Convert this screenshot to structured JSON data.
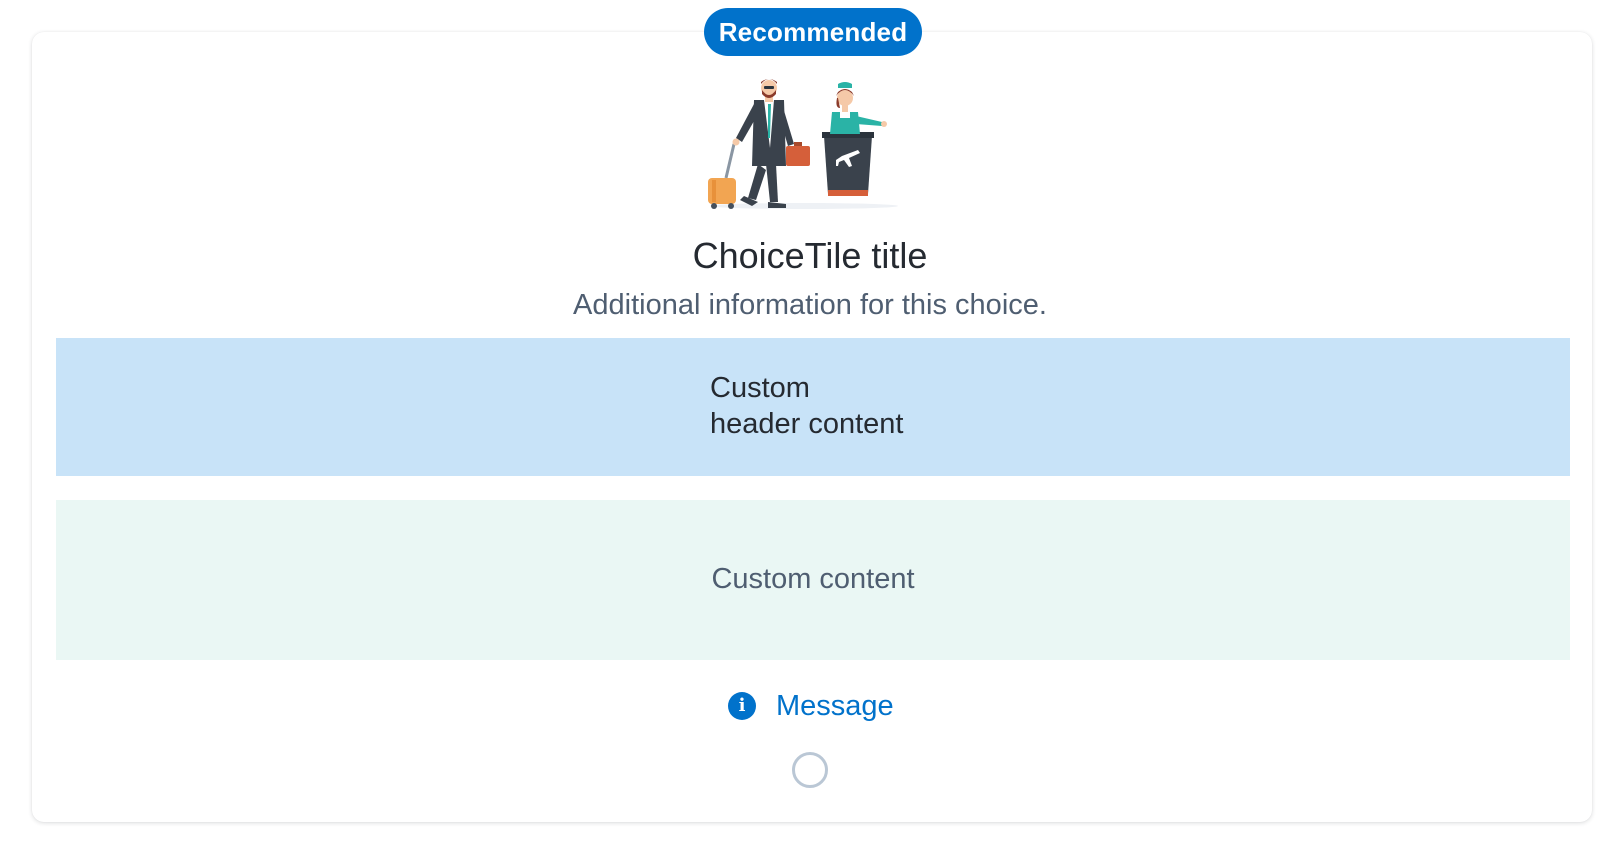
{
  "choice_tile": {
    "badge": "Recommended",
    "title": "ChoiceTile title",
    "description": "Additional information for this choice.",
    "custom_header": {
      "line1": "Custom",
      "line2": "header content"
    },
    "custom_content": "Custom content",
    "message": "Message",
    "message_icon": "info-icon",
    "illustration": "airport-check-in-illustration",
    "selected": false
  },
  "colors": {
    "badge_bg": "#0172cb",
    "header_bg": "#c8e3f8",
    "content_bg": "#eaf7f4",
    "message": "#0172cb",
    "radio_border": "#bac7d5"
  }
}
